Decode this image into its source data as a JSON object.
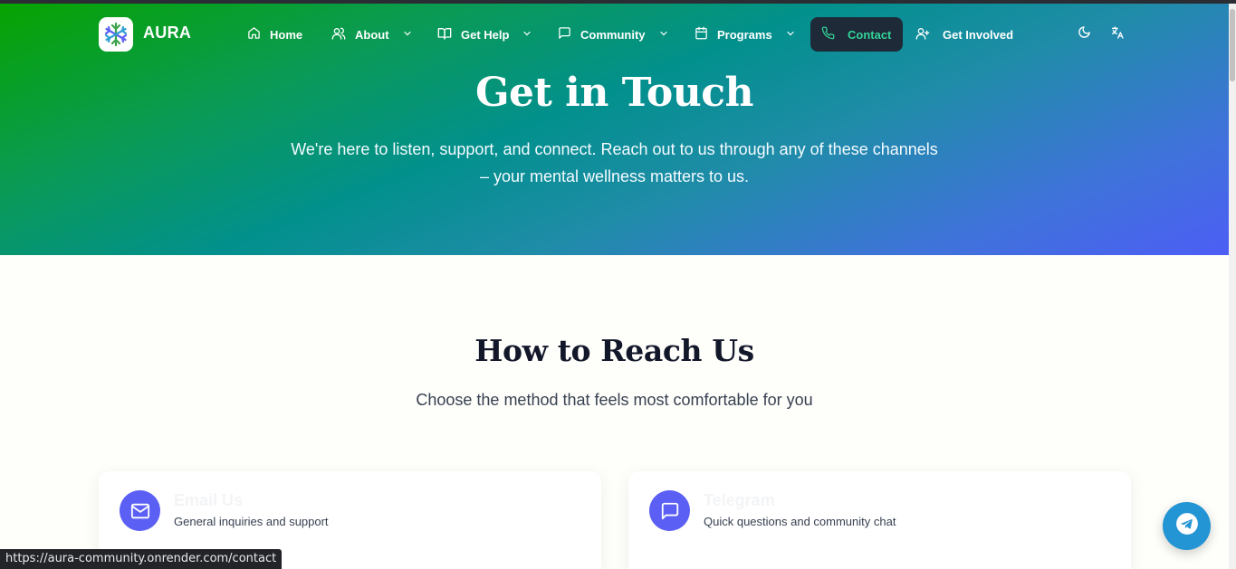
{
  "brand": {
    "name": "AURA"
  },
  "nav": {
    "items": [
      {
        "label": "Home",
        "icon": "home-icon"
      },
      {
        "label": "About",
        "icon": "users-icon"
      },
      {
        "label": "Get Help",
        "icon": "book-icon"
      },
      {
        "label": "Community",
        "icon": "message-icon"
      },
      {
        "label": "Programs",
        "icon": "calendar-icon"
      },
      {
        "label": "Contact",
        "icon": "phone-icon",
        "active": true
      },
      {
        "label": "Get Involved",
        "icon": "user-plus-icon"
      }
    ],
    "theme_icon": "moon-icon",
    "language_icon": "translate-icon"
  },
  "hero": {
    "title": "Get in Touch",
    "subtitle": "We're here to listen, support, and connect. Reach out to us through any of these channels – your mental wellness matters to us."
  },
  "section": {
    "title": "How to Reach Us",
    "subtitle": "Choose the method that feels most comfortable for you"
  },
  "cards": [
    {
      "title": "Email Us",
      "description": "General inquiries and support",
      "icon": "mail-icon"
    },
    {
      "title": "Telegram",
      "description": "Quick questions and community chat",
      "icon": "chat-icon"
    }
  ],
  "floating_button": {
    "icon": "telegram-icon"
  },
  "status_bar": {
    "url": "https://aura-community.onrender.com/contact"
  },
  "colors": {
    "accent": "#5b5ff3",
    "active_nav_bg": "#1e2a38",
    "active_nav_text": "#34d399",
    "telegram": "#2394d4"
  }
}
